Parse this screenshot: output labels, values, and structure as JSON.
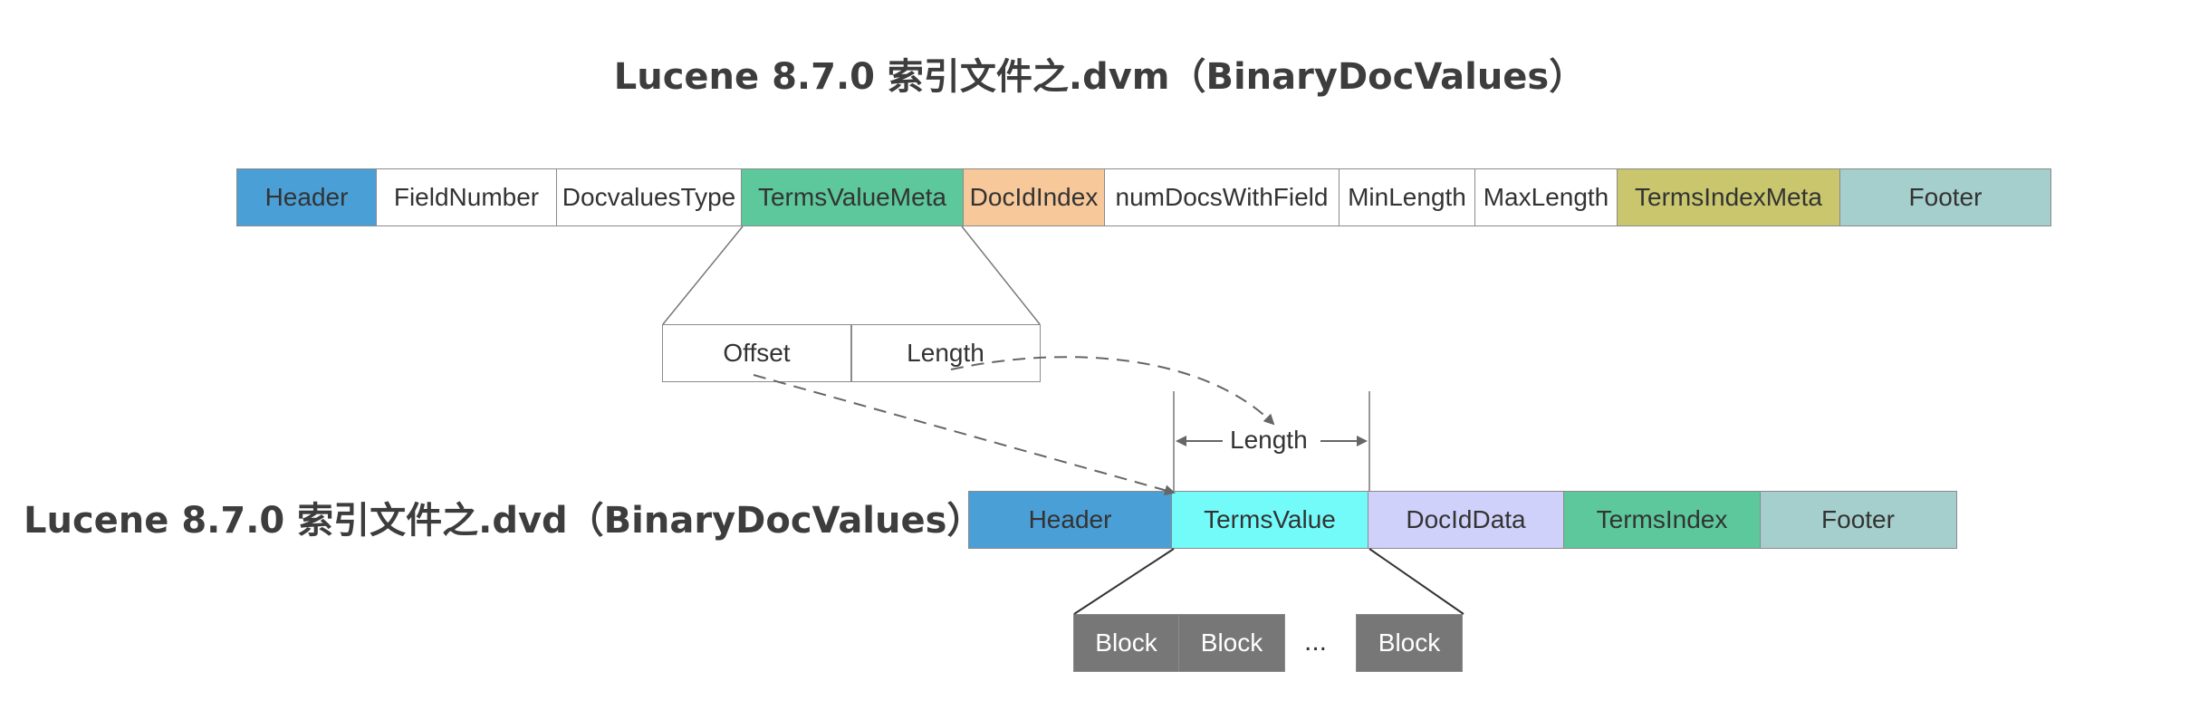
{
  "dvm_title": "Lucene 8.7.0 索引文件之.dvm（BinaryDocValues）",
  "dvd_title": "Lucene 8.7.0 索引文件之.dvd（BinaryDocValues）",
  "dvm_fields": [
    {
      "label": "Header",
      "color": "#4a9fd6"
    },
    {
      "label": "FieldNumber",
      "color": "#ffffff"
    },
    {
      "label": "DocvaluesType",
      "color": "#ffffff"
    },
    {
      "label": "TermsValueMeta",
      "color": "#5cc89b"
    },
    {
      "label": "DocIdIndex",
      "color": "#f7c89a"
    },
    {
      "label": "numDocsWithField",
      "color": "#ffffff"
    },
    {
      "label": "MinLength",
      "color": "#ffffff"
    },
    {
      "label": "MaxLength",
      "color": "#ffffff"
    },
    {
      "label": "TermsIndexMeta",
      "color": "#c9c66e"
    },
    {
      "label": "Footer",
      "color": "#a5cfcc"
    }
  ],
  "terms_value_meta_fields": [
    {
      "label": "Offset"
    },
    {
      "label": "Length"
    }
  ],
  "dvd_fields": [
    {
      "label": "Header",
      "color": "#4a9fd6"
    },
    {
      "label": "TermsValue",
      "color": "#73fbf9"
    },
    {
      "label": "DocIdData",
      "color": "#cfd1fa"
    },
    {
      "label": "TermsIndex",
      "color": "#5cc89b"
    },
    {
      "label": "Footer",
      "color": "#a5cfcc"
    }
  ],
  "length_label": "Length",
  "blocks": [
    "Block",
    "Block",
    "Block"
  ],
  "ellipsis": "..."
}
